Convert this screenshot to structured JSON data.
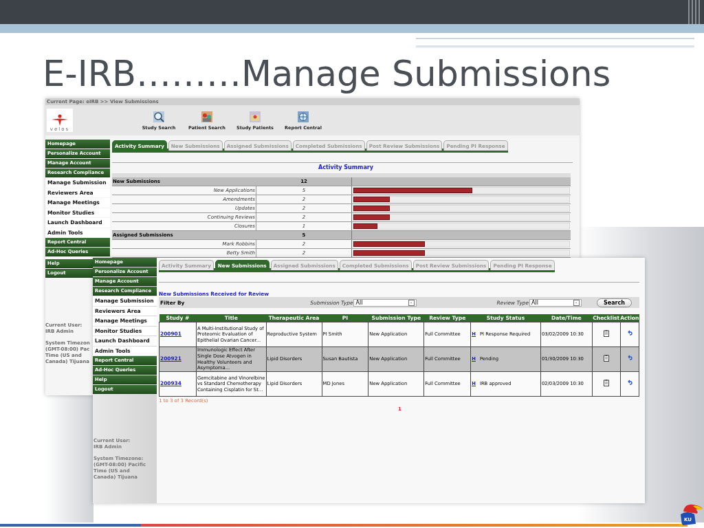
{
  "slide": {
    "title": "E-IRB………Manage Submissions",
    "badge": "KU"
  },
  "back_screen": {
    "breadcrumb": "Current Page: eIRB >> View Submissions",
    "logo_text": "velos",
    "toolbar": [
      {
        "label": "Study Search",
        "kind": "search"
      },
      {
        "label": "Patient Search",
        "kind": "patients"
      },
      {
        "label": "Study Patients",
        "kind": "study"
      },
      {
        "label": "Report Central",
        "kind": "report"
      }
    ],
    "nav": [
      {
        "label": "Homepage"
      },
      {
        "label": "Personalize Account"
      },
      {
        "label": "Manage Account"
      },
      {
        "label": "Research Compliance",
        "children": [
          {
            "label": "Manage Submission"
          },
          {
            "label": "Reviewers Area"
          },
          {
            "label": "Manage Meetings"
          },
          {
            "label": "Monitor Studies"
          },
          {
            "label": "Launch Dashboard"
          },
          {
            "label": "Admin Tools"
          }
        ]
      },
      {
        "label": "Report Central"
      },
      {
        "label": "Ad-Hoc Queries"
      }
    ],
    "nav_lower": [
      {
        "label": "Help"
      },
      {
        "label": "Logout"
      }
    ],
    "user_info": [
      {
        "lines": [
          "Current User:",
          "IRB Admin"
        ]
      },
      {
        "lines": [
          "System Timezon",
          "(GMT-08:00) Pac",
          "Time (US and",
          "Canada) Tijuana"
        ]
      }
    ],
    "tabs": [
      {
        "label": "Activity Summary",
        "selected": true
      },
      {
        "label": "New Submissions",
        "selected": false
      },
      {
        "label": "Assigned Submissions",
        "selected": false
      },
      {
        "label": "Completed Submissions",
        "selected": false
      },
      {
        "label": "Post Review Submissions",
        "selected": false
      },
      {
        "label": "Pending PI Response",
        "selected": false
      }
    ],
    "heading": "Activity Summary",
    "summary": [
      {
        "kind": "group",
        "label": "New Submissions",
        "count": "12"
      },
      {
        "kind": "item",
        "label": "New Applications",
        "count": "5",
        "level": 0.55
      },
      {
        "kind": "item",
        "label": "Amendments",
        "count": "2",
        "level": 0.17
      },
      {
        "kind": "item",
        "label": "Updates",
        "count": "2",
        "level": 0.17
      },
      {
        "kind": "item",
        "label": "Continuing Reviews",
        "count": "2",
        "level": 0.17
      },
      {
        "kind": "item",
        "label": "Closures",
        "count": "1",
        "level": 0.11
      },
      {
        "kind": "group",
        "label": "Assigned Submissions",
        "count": "5"
      },
      {
        "kind": "item",
        "label": "Mark Robbins",
        "count": "2",
        "level": 0.33
      },
      {
        "kind": "item",
        "label": "Betty Smith",
        "count": "2",
        "level": 0.33
      }
    ]
  },
  "front_screen": {
    "nav": [
      {
        "label": "Homepage"
      },
      {
        "label": "Personalize Account"
      },
      {
        "label": "Manage Account"
      },
      {
        "label": "Research Compliance",
        "children": [
          {
            "label": "Manage Submission"
          },
          {
            "label": "Reviewers Area"
          },
          {
            "label": "Manage Meetings"
          },
          {
            "label": "Monitor Studies"
          },
          {
            "label": "Launch Dashboard"
          },
          {
            "label": "Admin Tools"
          }
        ]
      },
      {
        "label": "Report Central"
      },
      {
        "label": "Ad-Hoc Queries"
      },
      {
        "label": "Help"
      },
      {
        "label": "Logout"
      }
    ],
    "user_info": [
      {
        "lines": [
          "Current User:",
          "IRB Admin"
        ]
      },
      {
        "lines": [
          "System Timezone:",
          "(GMT-08:00) Pacific",
          "Time (US and",
          "Canada) Tijuana"
        ]
      }
    ],
    "tabs": [
      {
        "label": "Activity Summary",
        "selected": false
      },
      {
        "label": "New Submissions",
        "selected": true
      },
      {
        "label": "Assigned Submissions",
        "selected": false
      },
      {
        "label": "Completed Submissions",
        "selected": false
      },
      {
        "label": "Post Review Submissions",
        "selected": false
      },
      {
        "label": "Pending PI Response",
        "selected": false
      }
    ],
    "heading": "New Submissions Received for Review",
    "filter": {
      "label": "Filter By",
      "submission_type_label": "Submission Type",
      "submission_type": "All",
      "review_type_label": "Review Type",
      "review_type": "All",
      "search_button": "Search"
    },
    "columns": [
      "Study #",
      "Title",
      "Therapeutic Area",
      "PI",
      "Submission Type",
      "Review Type",
      "Study Status",
      "Date/Time",
      "Checklist",
      "Action"
    ],
    "rows": [
      {
        "study": "200901",
        "title": "A Multi-Institutional Study of Proteomic Evaluation of Epithelial Ovarian Cancer...",
        "area": "Reproductive System",
        "pi": "PI Smith",
        "submission_type": "New Application",
        "review_type": "Full Committee",
        "history_link": "H",
        "status": "PI Response Required",
        "date": "03/02/2009 10:30",
        "selected": false
      },
      {
        "study": "200921",
        "title": "Immunologic Effect After Single Dose Atvogen in Healthy Volunteers and Asymptoma...",
        "area": "Lipid Disorders",
        "pi": "Susan Bautista",
        "submission_type": "New Application",
        "review_type": "Full Committee",
        "history_link": "H",
        "status": "Pending",
        "date": "01/30/2009 10:30",
        "selected": true
      },
      {
        "study": "200934",
        "title": "Gemcitabine and Vinorelbine vs Standard Chemotherapy Containing Cisplatin for St...",
        "area": "Lipid Disorders",
        "pi": "MD Jones",
        "submission_type": "New Application",
        "review_type": "Full Committee",
        "history_link": "H",
        "status": "IRB approved",
        "date": "02/03/2009 10:30",
        "selected": false
      }
    ],
    "record_count": "1 to 3 of 3 Record(s)",
    "pages": [
      "1"
    ]
  }
}
